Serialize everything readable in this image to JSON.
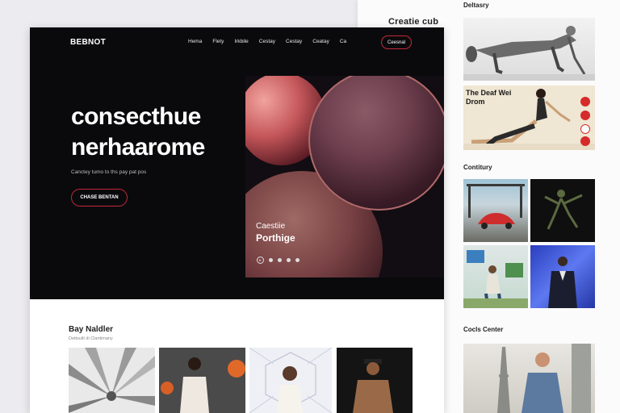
{
  "back": {
    "title": "Creatie cub",
    "sections": [
      {
        "title": "Deltasry"
      },
      {
        "title": "Contitury"
      },
      {
        "title": "Cocls Center"
      }
    ],
    "promo": {
      "text": "The Deaf Wei Drom"
    }
  },
  "front": {
    "logo": "BEBNOT",
    "nav": [
      "Hema",
      "Flety",
      "Irkbile",
      "Cestay",
      "Cestay",
      "Ceatay",
      "Ca"
    ],
    "nav_cta": "Ceesnal",
    "headline_1": "consecthue",
    "headline_2": "nerhaarome",
    "subline": "Canctey tumo to ths pay pat pos",
    "hero_button": "CHASE BENTAN",
    "art_caption_1": "Caestiie",
    "art_caption_2": "Porthige",
    "section_title": "Bay Naldler",
    "section_sub": "Dettsuilt di Clantimany"
  },
  "colors": {
    "accent": "#c3293a",
    "hero_bg": "#0a0a0c",
    "page_bg": "#ecebef"
  }
}
